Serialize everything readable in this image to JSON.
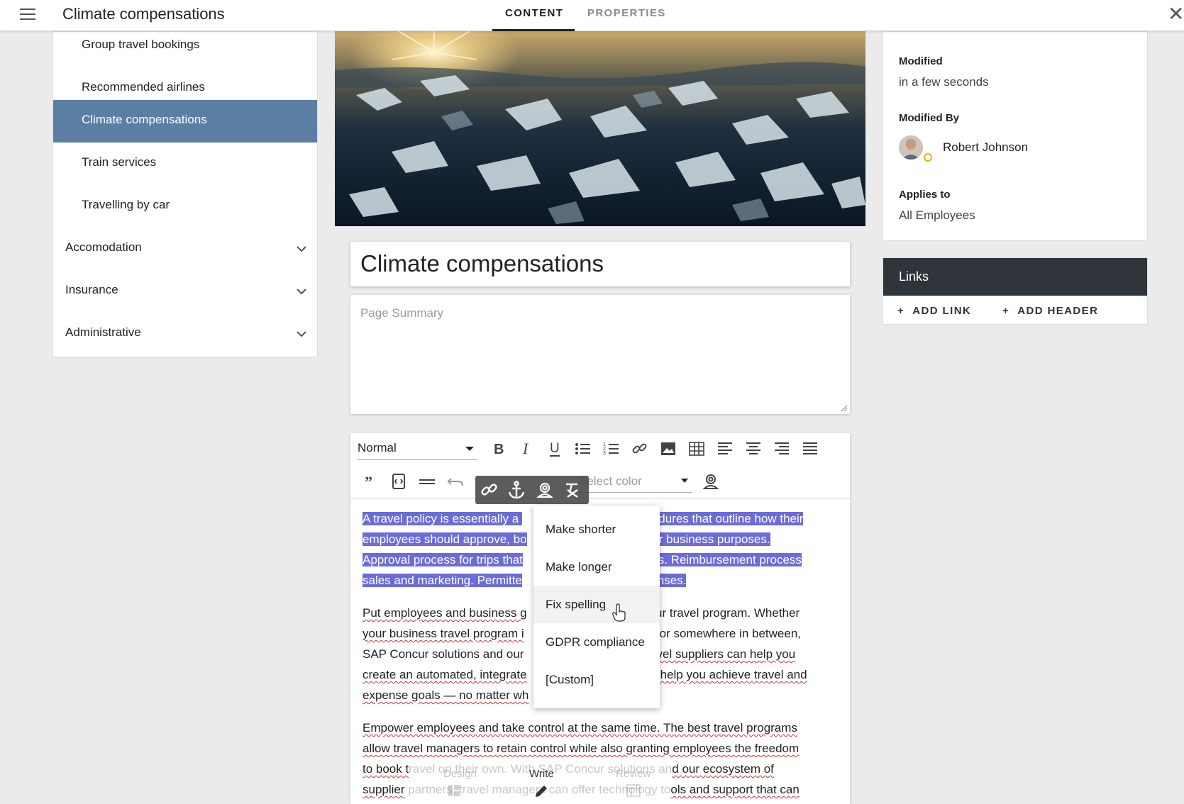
{
  "header": {
    "title": "Climate compensations",
    "tabs": [
      {
        "label": "CONTENT",
        "active": true
      },
      {
        "label": "PROPERTIES",
        "active": false
      }
    ]
  },
  "sidebar": {
    "items": [
      {
        "label": "Group travel bookings",
        "level": "sub"
      },
      {
        "label": "Recommended airlines",
        "level": "sub"
      },
      {
        "label": "Climate compensations",
        "level": "sub",
        "active": true
      },
      {
        "label": "Train services",
        "level": "sub"
      },
      {
        "label": "Travelling by car",
        "level": "sub"
      },
      {
        "label": "Accomodation",
        "level": "top",
        "expandable": true
      },
      {
        "label": "Insurance",
        "level": "top",
        "expandable": true
      },
      {
        "label": "Administrative",
        "level": "top",
        "expandable": true
      }
    ]
  },
  "page": {
    "title": "Climate compensations",
    "summary_placeholder": "Page Summary"
  },
  "editor": {
    "style_select": "Normal",
    "color_placeholder": "Select color",
    "paragraph1": {
      "part1": "A travel policy is essentially a ",
      "part2": "ocedures that outline how their",
      "part3": "employees should approve, bo",
      "part4": "for business purposes.",
      "part5": "Approval process for trips that",
      "part6": "ons. Reimbursement process",
      "part7": "sales and marketing. Permitte",
      "part8": "penses."
    },
    "paragraph2": {
      "line1a": "Put employees and business g",
      "line1b": "our travel program. Whether",
      "line2a": "your business travel program i",
      "line2b": "d, or somewhere in between,",
      "line3a": "SAP Concur solutions and our",
      "line3b": "ravel suppliers can help you",
      "line4a": "create an automated, integrate",
      "line4b": "ill help you achieve travel and",
      "line5a": "expense goals — no matter wh"
    },
    "paragraph3": {
      "line1": "Empower employees and take control at the same time. The best travel programs",
      "line2": "allow travel managers to retain control while also granting employees the freedom",
      "line3a": "to book t",
      "line3b": "ravel on their own. With SAP Concur solutions an",
      "line3c": "d our ecosystem of",
      "line4a": "supplier",
      "line4b": " partners, travel managers can offer technology to",
      "line4c": "ols and support that can"
    }
  },
  "ai_menu": {
    "items": [
      "Make shorter",
      "Make longer",
      "Fix spelling",
      "GDPR compliance",
      "[Custom]"
    ]
  },
  "bottom_toolbar": {
    "design": "Design",
    "write": "Write",
    "review": "Review"
  },
  "properties": {
    "modified_label": "Modified",
    "modified_value": "in a few seconds",
    "modified_by_label": "Modified By",
    "modified_by_value": "Robert Johnson",
    "applies_to_label": "Applies to",
    "applies_to_value": "All Employees"
  },
  "links": {
    "title": "Links",
    "add_link": "ADD LINK",
    "add_header": "ADD HEADER"
  },
  "colors": {
    "active_nav": "#5b7fa4",
    "selection": "#6c6cd9",
    "links_header": "#2f343b"
  }
}
